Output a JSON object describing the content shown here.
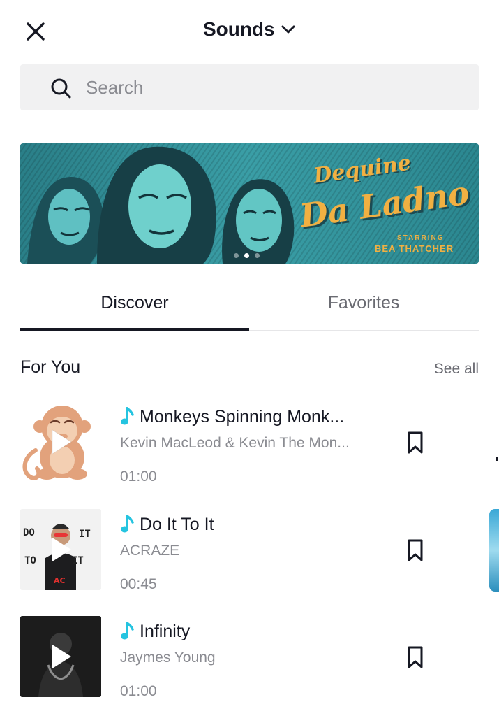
{
  "header": {
    "title": "Sounds",
    "close_icon": "close-icon",
    "dropdown_icon": "chevron-down-icon"
  },
  "search": {
    "placeholder": "Search",
    "value": "",
    "icon": "search-icon"
  },
  "banner": {
    "title_line1": "Dequine",
    "title_line2": "Da Ladno",
    "subtitle_line1": "STARRING",
    "subtitle_line2": "BEA THATCHER",
    "carousel_pages": 3,
    "active_page": 2
  },
  "tabs": [
    {
      "label": "Discover",
      "active": true
    },
    {
      "label": "Favorites",
      "active": false
    }
  ],
  "section": {
    "title": "For You",
    "see_all": "See all"
  },
  "tracks": [
    {
      "name": "Monkeys Spinning Monk...",
      "artist": "Kevin MacLeod & Kevin The Mon...",
      "duration": "01:00",
      "cover": "monkey-cover"
    },
    {
      "name": "Do It To It",
      "artist": "ACRAZE",
      "duration": "00:45",
      "cover": "do-it-to-it-cover"
    },
    {
      "name": "Infinity",
      "artist": "Jaymes Young",
      "duration": "01:00",
      "cover": "infinity-cover"
    }
  ],
  "colors": {
    "text_primary": "#161823",
    "text_secondary": "#8a8b91",
    "accent_note": "#25c4e0",
    "search_bg": "#f1f1f2",
    "banner_teal": "#2d8f98",
    "banner_gold": "#f1b042"
  }
}
